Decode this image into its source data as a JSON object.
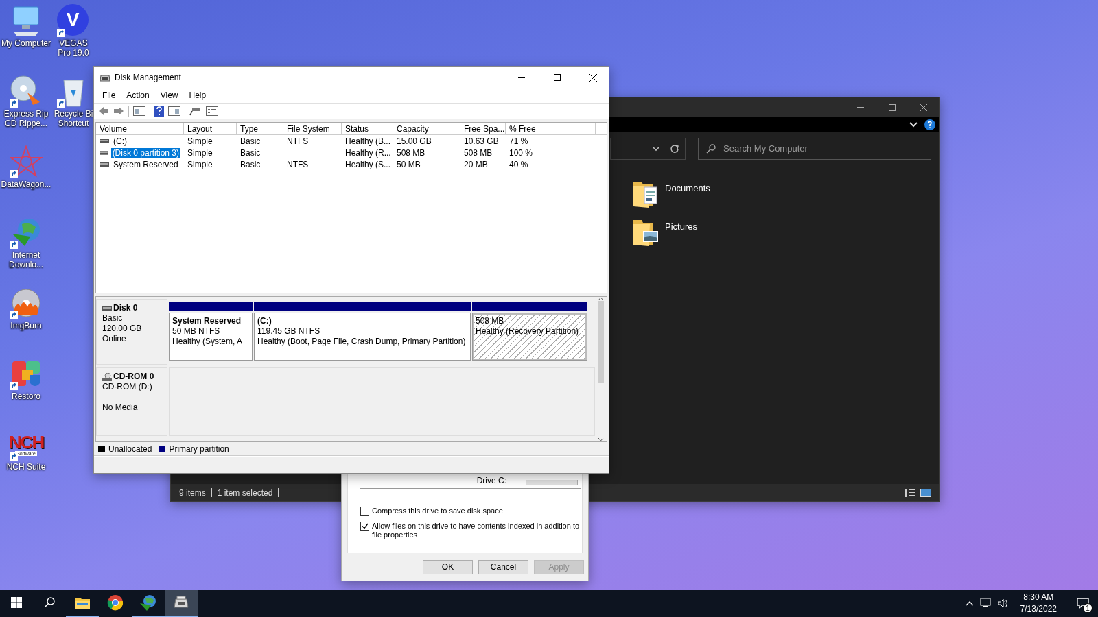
{
  "desktop_icons": [
    {
      "label": "My Computer",
      "kind": "computer",
      "shortcut": false
    },
    {
      "label": "Express Rip CD Rippe...",
      "kind": "disc-rip",
      "shortcut": true
    },
    {
      "label": "DataWagon...",
      "kind": "star",
      "shortcut": true
    },
    {
      "label": "Internet Downlo...",
      "kind": "globe",
      "shortcut": true
    },
    {
      "label": "ImgBurn",
      "kind": "burn",
      "shortcut": true
    },
    {
      "label": "Restoro",
      "kind": "restoro",
      "shortcut": true
    },
    {
      "label": "NCH Suite",
      "kind": "nch",
      "shortcut": true,
      "logo_text": "NCH",
      "logo_subtext": "Software"
    },
    {
      "label": "VEGAS Pro 19.0",
      "kind": "vegas",
      "shortcut": true,
      "logo_text": "V"
    },
    {
      "label": "Recycle Bi Shortcut",
      "kind": "recycle",
      "shortcut": true
    }
  ],
  "explorer": {
    "search": {
      "placeholder": "Search My Computer"
    },
    "items": [
      {
        "label": "Documents",
        "kind": "documents"
      },
      {
        "label": "Pictures",
        "kind": "pictures"
      }
    ],
    "status": [
      "9 items",
      "1 item selected"
    ]
  },
  "properties_dialog": {
    "drive_label": "Drive C:",
    "options": [
      {
        "label": "Compress this drive to save disk space",
        "checked": false
      },
      {
        "label": "Allow files on this drive to have contents indexed in addition to file properties",
        "checked": true
      }
    ],
    "buttons": [
      {
        "label": "OK",
        "disabled": false
      },
      {
        "label": "Cancel",
        "disabled": false
      },
      {
        "label": "Apply",
        "disabled": true
      }
    ]
  },
  "disk_management": {
    "title": "Disk Management",
    "menu": [
      "File",
      "Action",
      "View",
      "Help"
    ],
    "columns": [
      "Volume",
      "Layout",
      "Type",
      "File System",
      "Status",
      "Capacity",
      "Free Spa...",
      "% Free"
    ],
    "volumes": [
      {
        "cells": [
          "(C:)",
          "Simple",
          "Basic",
          "NTFS",
          "Healthy (B...",
          "15.00 GB",
          "10.63 GB",
          "71 %"
        ],
        "selected": false
      },
      {
        "cells": [
          "(Disk 0 partition 3)",
          "Simple",
          "Basic",
          "",
          "Healthy (R...",
          "508 MB",
          "508 MB",
          "100 %"
        ],
        "selected": true
      },
      {
        "cells": [
          "System Reserved",
          "Simple",
          "Basic",
          "NTFS",
          "Healthy (S...",
          "50 MB",
          "20 MB",
          "40 %"
        ],
        "selected": false
      }
    ],
    "disks": [
      {
        "name": "Disk 0",
        "kind": "disk",
        "type": "Basic",
        "size": "120.00 GB",
        "status": "Online",
        "partitions": [
          {
            "title": "System Reserved",
            "lines": [
              "50 MB NTFS",
              "Healthy (System, A"
            ],
            "selected": false
          },
          {
            "title": "(C:)",
            "lines": [
              "119.45 GB NTFS",
              "Healthy (Boot, Page File, Crash Dump, Primary Partition)"
            ],
            "selected": false
          },
          {
            "lines": [
              "508 MB",
              "Healthy (Recovery Partition)"
            ],
            "selected": true
          }
        ]
      },
      {
        "name": "CD-ROM 0",
        "kind": "cdrom",
        "type": "CD-ROM (D:)",
        "status": "No Media"
      }
    ],
    "legend": [
      {
        "label": "Unallocated",
        "color": "#000000"
      },
      {
        "label": "Primary partition",
        "color": "#000080"
      }
    ]
  },
  "taskbar": {
    "apps": [
      {
        "kind": "folder",
        "running": true,
        "active": false
      },
      {
        "kind": "browser",
        "running": false,
        "active": false
      },
      {
        "kind": "globe",
        "running": true,
        "active": false
      },
      {
        "kind": "diskmgmt",
        "running": true,
        "active": true
      }
    ],
    "time": "8:30 AM",
    "date": "7/13/2022",
    "notifications": "1"
  }
}
